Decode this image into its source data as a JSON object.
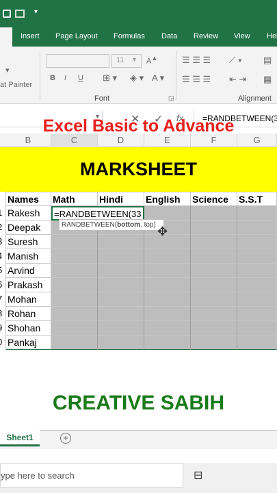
{
  "ribbon_tabs": [
    "Insert",
    "Page Layout",
    "Formulas",
    "Data",
    "Review",
    "View",
    "Hel"
  ],
  "home_tab": "e",
  "ribbon": {
    "font_group_label": "Font",
    "alignment_group_label": "Alignment",
    "format_painter_label": "at Painter",
    "font_size": "11",
    "bold": "B",
    "italic": "I",
    "underline": "U"
  },
  "formula_bar": {
    "formula": "=RANDBETWEEN(33",
    "fx": "fx"
  },
  "columns": [
    "B",
    "C",
    "D",
    "E",
    "F",
    "G"
  ],
  "overlay": {
    "title": "Excel Basic to Advance",
    "credit": "CREATIVE SABIH"
  },
  "banner_title": "MARKSHEET",
  "table": {
    "headers": [
      "Names",
      "Math",
      "Hindi",
      "English",
      "Science",
      "S.S.T"
    ],
    "rows": [
      {
        "no": "1",
        "name": "Rakesh"
      },
      {
        "no": "2",
        "name": "Deepak"
      },
      {
        "no": "3",
        "name": "Suresh"
      },
      {
        "no": "4",
        "name": "Manish"
      },
      {
        "no": "5",
        "name": "Arvind"
      },
      {
        "no": "6",
        "name": "Prakash"
      },
      {
        "no": "7",
        "name": "Mohan"
      },
      {
        "no": "8",
        "name": "Rohan"
      },
      {
        "no": "9",
        "name": "Shohan"
      },
      {
        "no": "0",
        "name": "Pankaj"
      }
    ],
    "active_cell_text": "=RANDBETWEEN(33"
  },
  "tooltip": {
    "fn": "RANDBETWEEN(",
    "arg1": "bottom",
    "rest": ", top)"
  },
  "sheet_tab": "Sheet1",
  "taskbar": {
    "search_placeholder": "ype here to search"
  }
}
